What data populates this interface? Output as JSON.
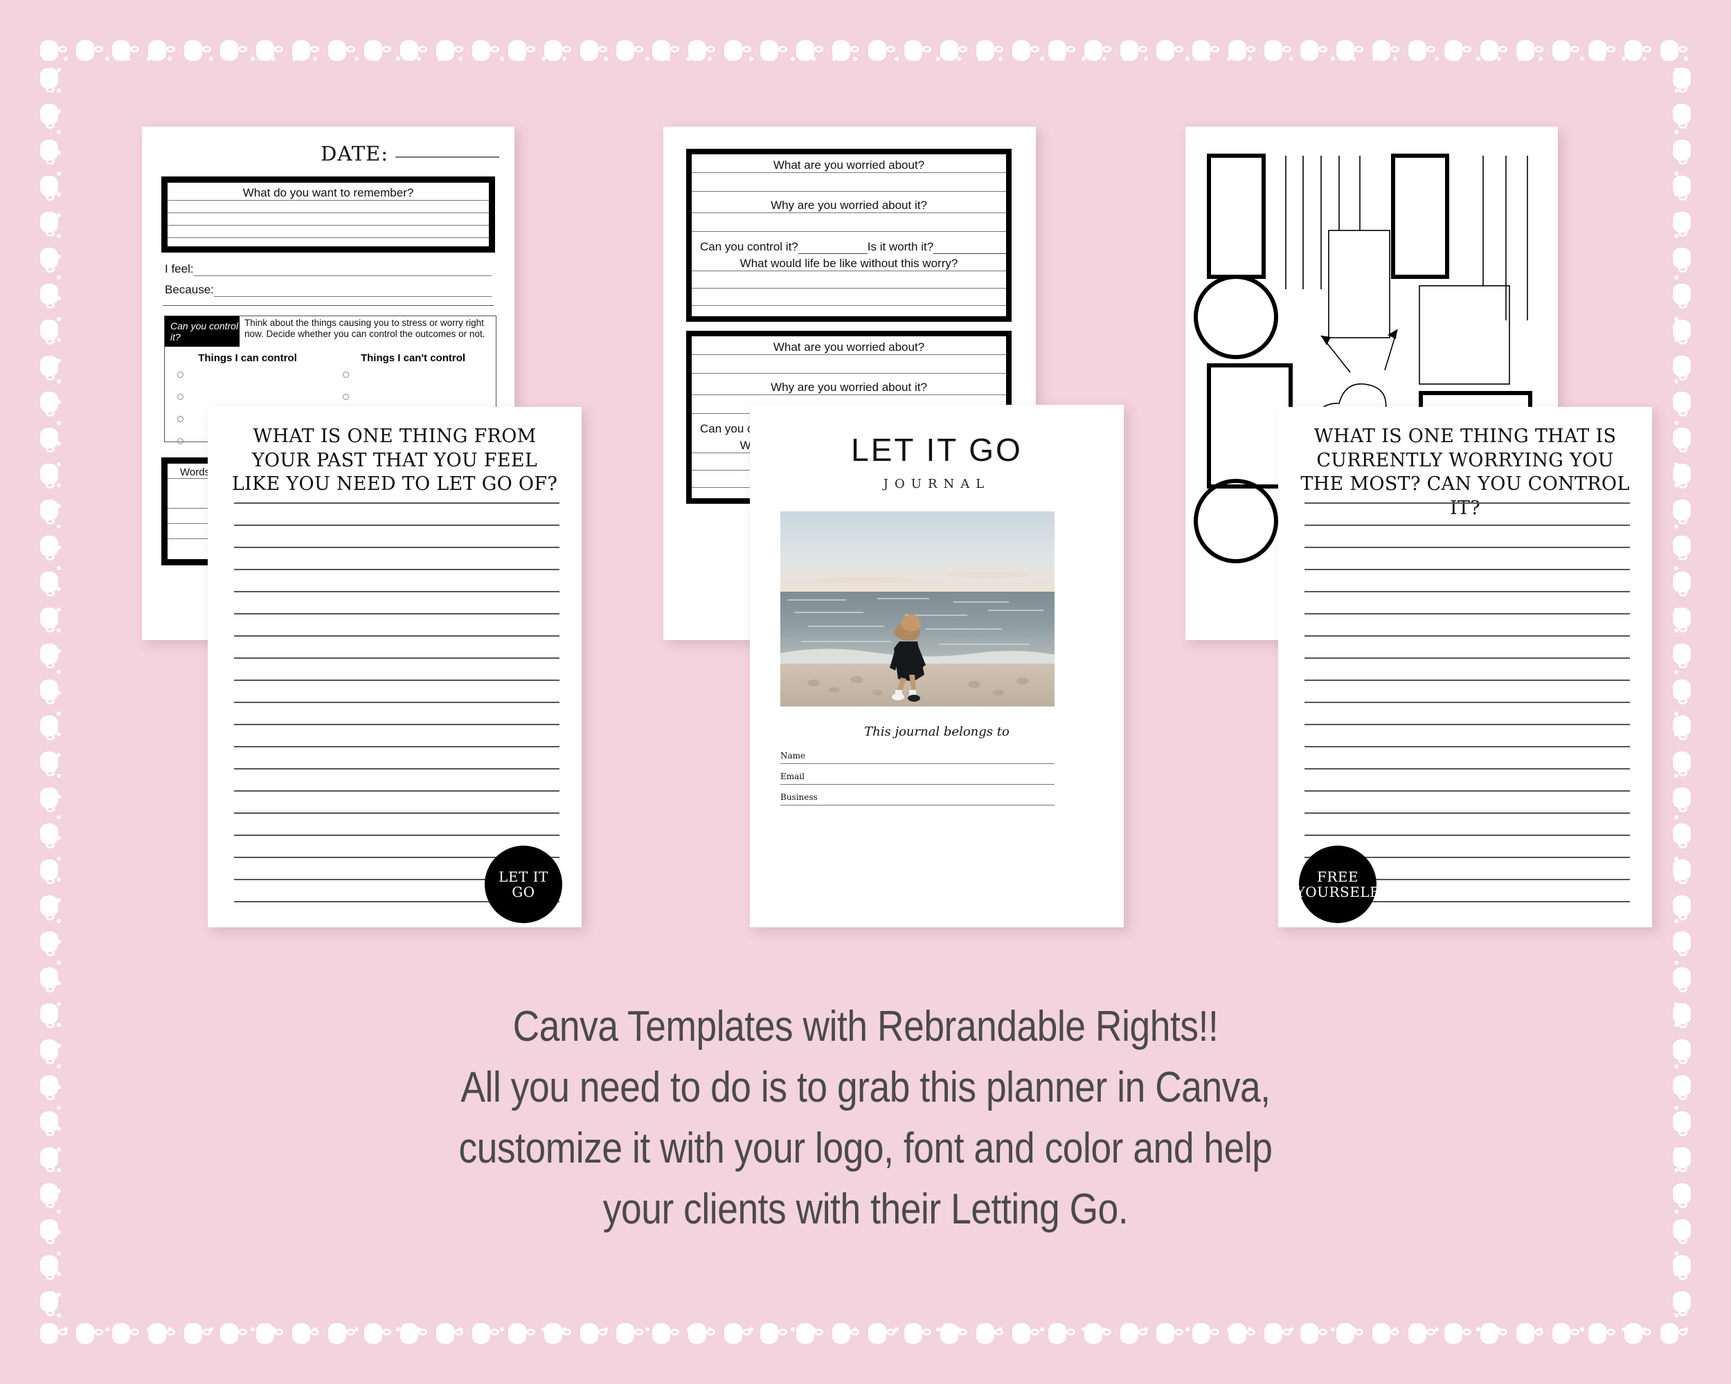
{
  "background": {
    "color": "#f3d3dd",
    "border_style": "white-dotted-frame"
  },
  "pages": {
    "date_page": {
      "date_label": "DATE:",
      "remember_question": "What do you want to remember?",
      "i_feel_label": "I feel:",
      "because_label": "Because:",
      "control_tag": "Can you control it?",
      "control_description": "Think about the things causing you to stress or worry right now. Decide whether you can control the outcomes or not.",
      "col_can": "Things I can control",
      "col_cant": "Things I can't control",
      "words_label": "Words"
    },
    "worry_page": {
      "q1": "What are you worried about?",
      "q2": "Why are you worried about it?",
      "q3a": "Can you control it?",
      "q3b": "Is it worth it?",
      "q4": "What would life be like without this worry?"
    },
    "vision_page": {
      "name": "vision-board-shapes"
    },
    "fg_left": {
      "title": "WHAT IS ONE THING FROM YOUR PAST THAT YOU FEEL LIKE YOU NEED TO LET GO OF?",
      "badge_line1": "LET IT",
      "badge_line2": "GO"
    },
    "fg_right": {
      "title": "WHAT IS ONE THING THAT IS CURRENTLY WORRYING YOU THE MOST? CAN YOU CONTROL IT?",
      "badge_line1": "FREE",
      "badge_line2": "YOURSELF"
    },
    "cover": {
      "title": "LET IT GO",
      "subtitle": "JOURNAL",
      "belongs": "This journal belongs to",
      "field_name": "Name",
      "field_email": "Email",
      "field_business": "Business",
      "photo_alt": "woman-running-on-beach-photo"
    }
  },
  "caption": {
    "line1": "Canva Templates with Rebrandable Rights!!",
    "line2": "All you need to do is to grab this planner in Canva,",
    "line3": "customize it with your logo, font and color and help",
    "line4": "your clients with their Letting Go.",
    "color": "#4a4a4a"
  }
}
